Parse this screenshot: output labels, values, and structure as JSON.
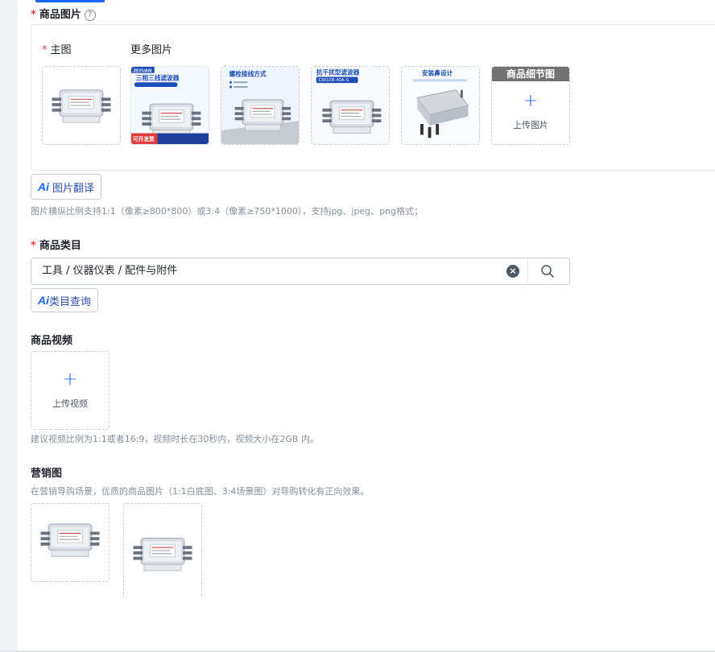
{
  "product_images": {
    "label": "商品图片",
    "help_icon": "question-circle-icon",
    "main_label": "主图",
    "more_label": "更多图片",
    "detail_head": "商品细节图",
    "upload_text": "上传图片",
    "ai_translate": "图片翻译",
    "hint": "图片横纵比例支持1:1（像素≥800*800）或3:4（像素≥750*1000），支持jpg、jpeg、png格式；",
    "thumb_texts": {
      "t2_brand": "JSYUAN",
      "t2_title": "三相三线滤波器",
      "t2_badge": "可开发票",
      "t3_title": "螺栓接线方式",
      "t4_title": "抗干扰型滤波器",
      "t4_model": "CW12B-40A-S",
      "t5_title": "安装鼻设计"
    }
  },
  "category": {
    "label": "商品类目",
    "value": "工具 / 仪器仪表 / 配件与附件",
    "ai_query": "类目查询"
  },
  "video": {
    "label": "商品视频",
    "upload_text": "上传视频",
    "hint": "建议视频比例为1:1或者16:9，视频时长在30秒内，视频大小在2GB 内。"
  },
  "marketing": {
    "label": "营销图",
    "hint": "在营销导购场景，优质的商品图片（1:1白底图、3:4场景图）对导购转化有正向效果。"
  },
  "colors": {
    "accent": "#1966ff",
    "required": "#f53f3f"
  }
}
